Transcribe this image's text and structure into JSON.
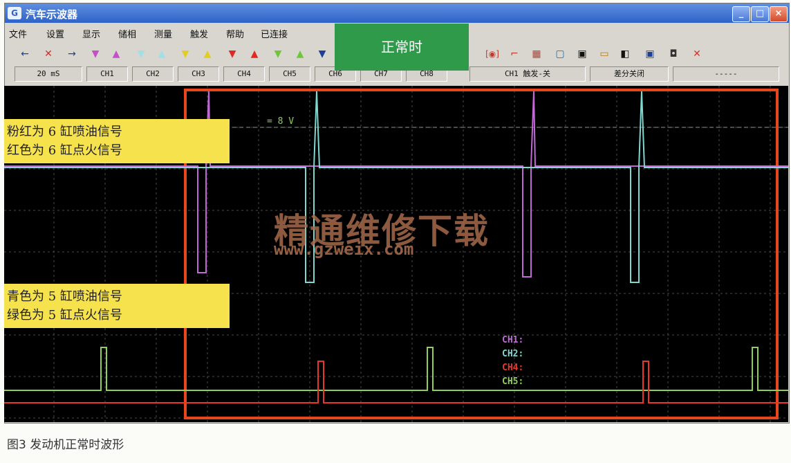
{
  "window": {
    "title": "汽车示波器",
    "app_icon": "oscilloscope-icon"
  },
  "menu": [
    "文件",
    "设置",
    "显示",
    "储相",
    "测量",
    "触发",
    "帮助",
    "已连接"
  ],
  "toolbar_icons": [
    "arrow-left-icon",
    "close-red-icon",
    "arrow-right-icon",
    "tri-down-magenta",
    "tri-up-magenta",
    "tri-down-cyan",
    "tri-up-cyan",
    "tri-down-yellow",
    "tri-up-yellow",
    "tri-down-red",
    "tri-up-red",
    "tri-down-green",
    "tri-up-green",
    "tri-down-blue",
    "trigger-icon",
    "cursor-icon",
    "grid-icon",
    "window-icon",
    "save-icon",
    "open-icon",
    "contrast-icon",
    "screen-icon",
    "camera-icon",
    "close-x-icon"
  ],
  "channel_bar": {
    "timebase": "20 mS",
    "channels": [
      "CH1",
      "CH2",
      "CH3",
      "CH4",
      "CH5",
      "CH6",
      "CH7",
      "CH8"
    ],
    "trigger": "CH1 触发-关",
    "diff": "差分关闭",
    "readout": "-----"
  },
  "badge": "正常时",
  "scope": {
    "voltage_label": "= 8 V",
    "callout_top": [
      "粉红为 6 缸喷油信号",
      "红色为 6 缸点火信号"
    ],
    "callout_bottom": [
      "青色为 5 缸喷油信号",
      "绿色为 5 缸点火信号"
    ],
    "legend": [
      {
        "label": "CH1:",
        "color": "#c06ad6"
      },
      {
        "label": "CH2:",
        "color": "#7fd8d0"
      },
      {
        "label": "CH4:",
        "color": "#e8362a"
      },
      {
        "label": "CH5:",
        "color": "#8ed05a"
      }
    ],
    "watermark": "精通维修下载",
    "watermark_url": "www.gzweix.com"
  },
  "caption": "图3   发动机正常时波形",
  "colors": {
    "ch1": "#c06ad6",
    "ch2": "#7fd8d0",
    "ch4": "#e8362a",
    "ch5": "#8ed05a",
    "frame": "#e8461c"
  }
}
